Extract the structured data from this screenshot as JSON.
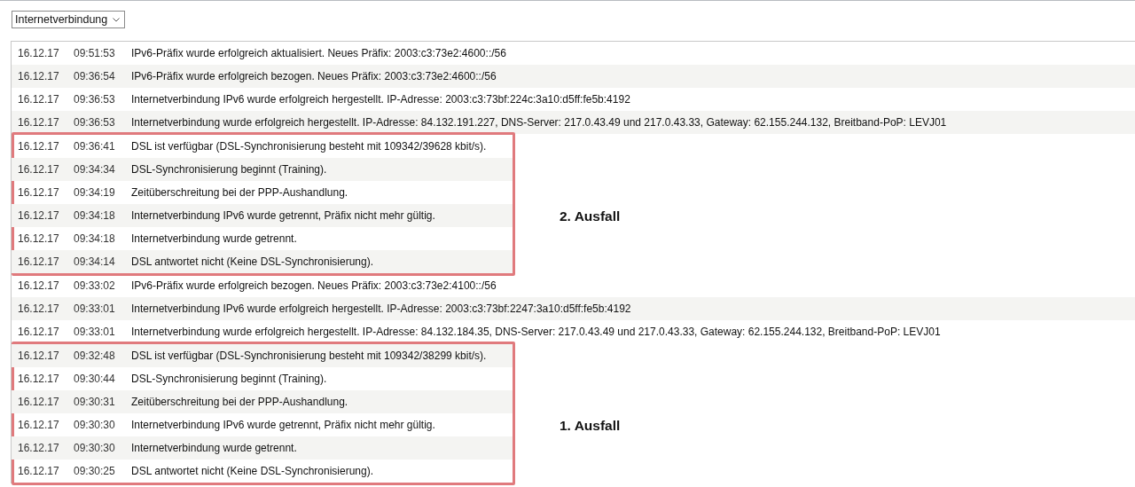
{
  "filter": {
    "value": "Internetverbindung"
  },
  "blocks": [
    {
      "kind": "plain",
      "entries": [
        {
          "date": "16.12.17",
          "time": "09:51:53",
          "message": "IPv6-Präfix wurde erfolgreich aktualisiert. Neues Präfix: 2003:c3:73e2:4600::/56"
        },
        {
          "date": "16.12.17",
          "time": "09:36:54",
          "message": "IPv6-Präfix wurde erfolgreich bezogen. Neues Präfix: 2003:c3:73e2:4600::/56"
        },
        {
          "date": "16.12.17",
          "time": "09:36:53",
          "message": "Internetverbindung IPv6 wurde erfolgreich hergestellt. IP-Adresse: 2003:c3:73bf:224c:3a10:d5ff:fe5b:4192"
        },
        {
          "date": "16.12.17",
          "time": "09:36:53",
          "message": "Internetverbindung wurde erfolgreich hergestellt. IP-Adresse: 84.132.191.227, DNS-Server: 217.0.43.49 und 217.0.43.33, Gateway: 62.155.244.132, Breitband-PoP: LEVJ01"
        }
      ]
    },
    {
      "kind": "outage",
      "label": "2. Ausfall",
      "entries": [
        {
          "date": "16.12.17",
          "time": "09:36:41",
          "message": "DSL ist verfügbar (DSL-Synchronisierung besteht mit 109342/39628 kbit/s)."
        },
        {
          "date": "16.12.17",
          "time": "09:34:34",
          "message": "DSL-Synchronisierung beginnt (Training)."
        },
        {
          "date": "16.12.17",
          "time": "09:34:19",
          "message": "Zeitüberschreitung bei der PPP-Aushandlung."
        },
        {
          "date": "16.12.17",
          "time": "09:34:18",
          "message": "Internetverbindung IPv6 wurde getrennt, Präfix nicht mehr gültig."
        },
        {
          "date": "16.12.17",
          "time": "09:34:18",
          "message": "Internetverbindung wurde getrennt."
        },
        {
          "date": "16.12.17",
          "time": "09:34:14",
          "message": "DSL antwortet nicht (Keine DSL-Synchronisierung)."
        }
      ]
    },
    {
      "kind": "plain",
      "entries": [
        {
          "date": "16.12.17",
          "time": "09:33:02",
          "message": "IPv6-Präfix wurde erfolgreich bezogen. Neues Präfix: 2003:c3:73e2:4100::/56"
        },
        {
          "date": "16.12.17",
          "time": "09:33:01",
          "message": "Internetverbindung IPv6 wurde erfolgreich hergestellt. IP-Adresse: 2003:c3:73bf:2247:3a10:d5ff:fe5b:4192"
        },
        {
          "date": "16.12.17",
          "time": "09:33:01",
          "message": "Internetverbindung wurde erfolgreich hergestellt. IP-Adresse: 84.132.184.35, DNS-Server: 217.0.43.49 und 217.0.43.33, Gateway: 62.155.244.132, Breitband-PoP: LEVJ01"
        }
      ]
    },
    {
      "kind": "outage",
      "label": "1. Ausfall",
      "entries": [
        {
          "date": "16.12.17",
          "time": "09:32:48",
          "message": "DSL ist verfügbar (DSL-Synchronisierung besteht mit 109342/38299 kbit/s)."
        },
        {
          "date": "16.12.17",
          "time": "09:30:44",
          "message": "DSL-Synchronisierung beginnt (Training)."
        },
        {
          "date": "16.12.17",
          "time": "09:30:31",
          "message": "Zeitüberschreitung bei der PPP-Aushandlung."
        },
        {
          "date": "16.12.17",
          "time": "09:30:30",
          "message": "Internetverbindung IPv6 wurde getrennt, Präfix nicht mehr gültig."
        },
        {
          "date": "16.12.17",
          "time": "09:30:30",
          "message": "Internetverbindung wurde getrennt."
        },
        {
          "date": "16.12.17",
          "time": "09:30:25",
          "message": "DSL antwortet nicht (Keine DSL-Synchronisierung)."
        }
      ]
    }
  ]
}
